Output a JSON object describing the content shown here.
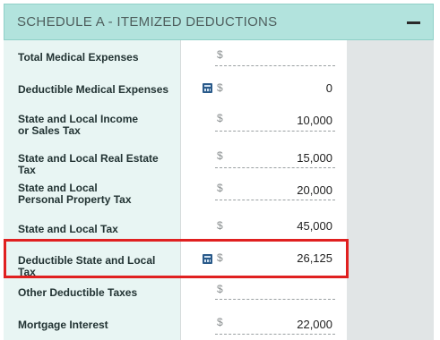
{
  "section": {
    "title": "SCHEDULE A - ITEMIZED DEDUCTIONS"
  },
  "currency_symbol": "$",
  "rows": [
    {
      "label": "Total Medical Expenses",
      "value": "",
      "calculated": false
    },
    {
      "label": "Deductible Medical Expenses",
      "value": "0",
      "calculated": true
    },
    {
      "label": "State and Local Income or Sales Tax",
      "value": "10,000",
      "calculated": false
    },
    {
      "label": "State and Local Real Estate Tax",
      "value": "15,000",
      "calculated": false
    },
    {
      "label": "State and Local Personal Property Tax",
      "value": "20,000",
      "calculated": false
    },
    {
      "label": "State and Local Tax",
      "value": "45,000",
      "calculated": false
    },
    {
      "label": "Deductible State and Local Tax",
      "value": "26,125",
      "calculated": true
    },
    {
      "label": "Other Deductible Taxes",
      "value": "",
      "calculated": false
    },
    {
      "label": "Mortgage Interest",
      "value": "22,000",
      "calculated": false
    }
  ],
  "colors": {
    "header_bg": "#b2e3dd",
    "label_bg": "#e8f5f3",
    "highlight_border": "#e02020"
  }
}
